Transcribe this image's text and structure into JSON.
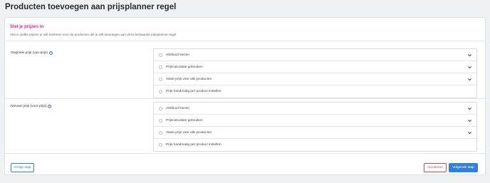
{
  "page": {
    "title": "Producten toevoegen aan prijsplanner regel"
  },
  "section": {
    "title": "Stel je prijzen in",
    "description": "Stel in welke prijzen je wilt hanteren voor de producten die je wilt toevoegen aan deze bestaande prijsplanner regel"
  },
  "original_price": {
    "label": "Originele prijs (van-prijs)",
    "info_icon": "info-icon",
    "options": [
      {
        "label": "Attribuut kiezen",
        "expandable": true
      },
      {
        "label": "Prijscalculatie gebruiken",
        "expandable": true
      },
      {
        "label": "Vaste prijs voor alle producten",
        "expandable": true
      },
      {
        "label": "Prijs handmatig per product instellen",
        "expandable": false
      }
    ]
  },
  "new_price": {
    "label": "Nieuwe prijs (voor-prijs)",
    "info_icon": "info-icon",
    "options": [
      {
        "label": "Attribuut kiezen",
        "expandable": true
      },
      {
        "label": "Prijscalculatie gebruiken",
        "expandable": true
      },
      {
        "label": "Vaste prijs voor alle producten",
        "expandable": true
      },
      {
        "label": "Prijs handmatig per product instellen",
        "expandable": false
      }
    ]
  },
  "footer": {
    "prev_label": "Vorige stap",
    "cancel_label": "Annuleren",
    "next_label": "Volgende stap"
  },
  "colors": {
    "accent": "#2f80d8",
    "section_title": "#e0218a",
    "danger": "#d9484b"
  }
}
